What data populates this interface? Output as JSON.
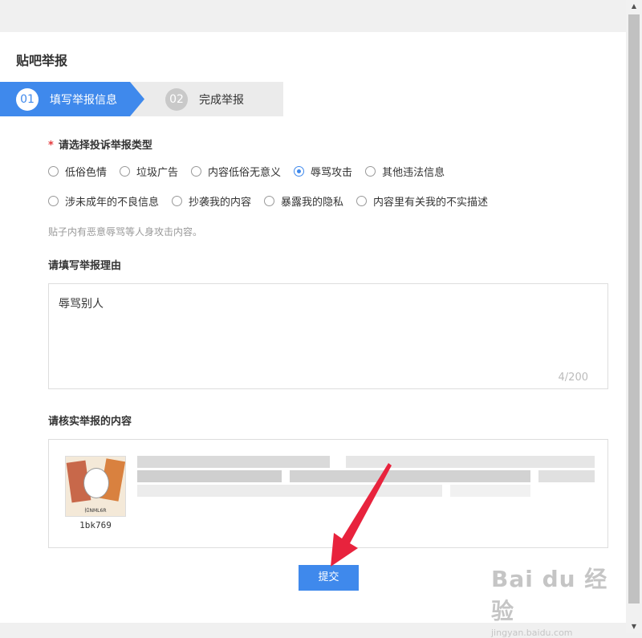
{
  "title": "贴吧举报",
  "steps": [
    {
      "num": "01",
      "label": "填写举报信息"
    },
    {
      "num": "02",
      "label": "完成举报"
    }
  ],
  "report_type": {
    "required_mark": "*",
    "label": "请选择投诉举报类型",
    "options_row1": [
      {
        "label": "低俗色情",
        "checked": false
      },
      {
        "label": "垃圾广告",
        "checked": false
      },
      {
        "label": "内容低俗无意义",
        "checked": false
      },
      {
        "label": "辱骂攻击",
        "checked": true
      },
      {
        "label": "其他违法信息",
        "checked": false
      }
    ],
    "options_row2": [
      {
        "label": "涉未成年的不良信息",
        "checked": false
      },
      {
        "label": "抄袭我的内容",
        "checked": false
      },
      {
        "label": "暴露我的隐私",
        "checked": false
      },
      {
        "label": "内容里有关我的不实描述",
        "checked": false
      }
    ],
    "hint": "贴子内有恶意辱骂等人身攻击内容。"
  },
  "reason": {
    "label": "请填写举报理由",
    "value": "辱骂别人",
    "counter": "4/200"
  },
  "verify": {
    "label": "请核实举报的内容",
    "avatar_caption": "拉NML6R",
    "username": "1bk769"
  },
  "submit_label": "提交",
  "watermark": {
    "logo": "Bai du 经验",
    "url": "jingyan.baidu.com"
  },
  "colors": {
    "accent": "#3f89ec",
    "required": "#e4393c",
    "annotation_arrow": "#e8233d"
  }
}
